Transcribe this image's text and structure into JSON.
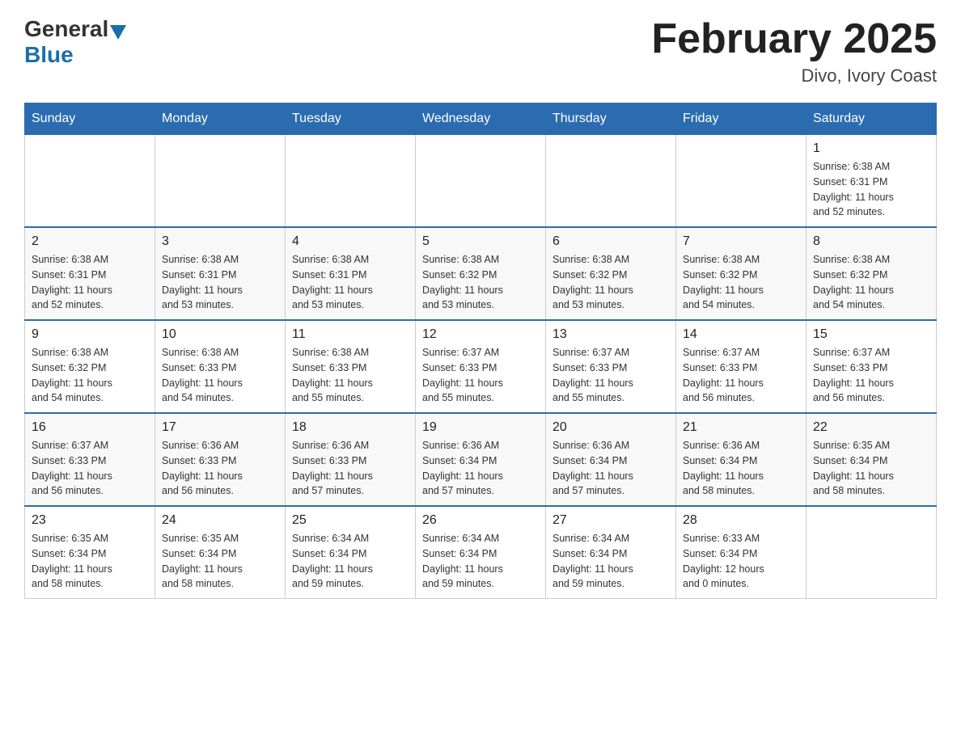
{
  "header": {
    "logo_general": "General",
    "logo_blue": "Blue",
    "month_title": "February 2025",
    "location": "Divo, Ivory Coast"
  },
  "days_of_week": [
    "Sunday",
    "Monday",
    "Tuesday",
    "Wednesday",
    "Thursday",
    "Friday",
    "Saturday"
  ],
  "weeks": [
    {
      "days": [
        {
          "num": "",
          "info": ""
        },
        {
          "num": "",
          "info": ""
        },
        {
          "num": "",
          "info": ""
        },
        {
          "num": "",
          "info": ""
        },
        {
          "num": "",
          "info": ""
        },
        {
          "num": "",
          "info": ""
        },
        {
          "num": "1",
          "info": "Sunrise: 6:38 AM\nSunset: 6:31 PM\nDaylight: 11 hours\nand 52 minutes."
        }
      ]
    },
    {
      "days": [
        {
          "num": "2",
          "info": "Sunrise: 6:38 AM\nSunset: 6:31 PM\nDaylight: 11 hours\nand 52 minutes."
        },
        {
          "num": "3",
          "info": "Sunrise: 6:38 AM\nSunset: 6:31 PM\nDaylight: 11 hours\nand 53 minutes."
        },
        {
          "num": "4",
          "info": "Sunrise: 6:38 AM\nSunset: 6:31 PM\nDaylight: 11 hours\nand 53 minutes."
        },
        {
          "num": "5",
          "info": "Sunrise: 6:38 AM\nSunset: 6:32 PM\nDaylight: 11 hours\nand 53 minutes."
        },
        {
          "num": "6",
          "info": "Sunrise: 6:38 AM\nSunset: 6:32 PM\nDaylight: 11 hours\nand 53 minutes."
        },
        {
          "num": "7",
          "info": "Sunrise: 6:38 AM\nSunset: 6:32 PM\nDaylight: 11 hours\nand 54 minutes."
        },
        {
          "num": "8",
          "info": "Sunrise: 6:38 AM\nSunset: 6:32 PM\nDaylight: 11 hours\nand 54 minutes."
        }
      ]
    },
    {
      "days": [
        {
          "num": "9",
          "info": "Sunrise: 6:38 AM\nSunset: 6:32 PM\nDaylight: 11 hours\nand 54 minutes."
        },
        {
          "num": "10",
          "info": "Sunrise: 6:38 AM\nSunset: 6:33 PM\nDaylight: 11 hours\nand 54 minutes."
        },
        {
          "num": "11",
          "info": "Sunrise: 6:38 AM\nSunset: 6:33 PM\nDaylight: 11 hours\nand 55 minutes."
        },
        {
          "num": "12",
          "info": "Sunrise: 6:37 AM\nSunset: 6:33 PM\nDaylight: 11 hours\nand 55 minutes."
        },
        {
          "num": "13",
          "info": "Sunrise: 6:37 AM\nSunset: 6:33 PM\nDaylight: 11 hours\nand 55 minutes."
        },
        {
          "num": "14",
          "info": "Sunrise: 6:37 AM\nSunset: 6:33 PM\nDaylight: 11 hours\nand 56 minutes."
        },
        {
          "num": "15",
          "info": "Sunrise: 6:37 AM\nSunset: 6:33 PM\nDaylight: 11 hours\nand 56 minutes."
        }
      ]
    },
    {
      "days": [
        {
          "num": "16",
          "info": "Sunrise: 6:37 AM\nSunset: 6:33 PM\nDaylight: 11 hours\nand 56 minutes."
        },
        {
          "num": "17",
          "info": "Sunrise: 6:36 AM\nSunset: 6:33 PM\nDaylight: 11 hours\nand 56 minutes."
        },
        {
          "num": "18",
          "info": "Sunrise: 6:36 AM\nSunset: 6:33 PM\nDaylight: 11 hours\nand 57 minutes."
        },
        {
          "num": "19",
          "info": "Sunrise: 6:36 AM\nSunset: 6:34 PM\nDaylight: 11 hours\nand 57 minutes."
        },
        {
          "num": "20",
          "info": "Sunrise: 6:36 AM\nSunset: 6:34 PM\nDaylight: 11 hours\nand 57 minutes."
        },
        {
          "num": "21",
          "info": "Sunrise: 6:36 AM\nSunset: 6:34 PM\nDaylight: 11 hours\nand 58 minutes."
        },
        {
          "num": "22",
          "info": "Sunrise: 6:35 AM\nSunset: 6:34 PM\nDaylight: 11 hours\nand 58 minutes."
        }
      ]
    },
    {
      "days": [
        {
          "num": "23",
          "info": "Sunrise: 6:35 AM\nSunset: 6:34 PM\nDaylight: 11 hours\nand 58 minutes."
        },
        {
          "num": "24",
          "info": "Sunrise: 6:35 AM\nSunset: 6:34 PM\nDaylight: 11 hours\nand 58 minutes."
        },
        {
          "num": "25",
          "info": "Sunrise: 6:34 AM\nSunset: 6:34 PM\nDaylight: 11 hours\nand 59 minutes."
        },
        {
          "num": "26",
          "info": "Sunrise: 6:34 AM\nSunset: 6:34 PM\nDaylight: 11 hours\nand 59 minutes."
        },
        {
          "num": "27",
          "info": "Sunrise: 6:34 AM\nSunset: 6:34 PM\nDaylight: 11 hours\nand 59 minutes."
        },
        {
          "num": "28",
          "info": "Sunrise: 6:33 AM\nSunset: 6:34 PM\nDaylight: 12 hours\nand 0 minutes."
        },
        {
          "num": "",
          "info": ""
        }
      ]
    }
  ]
}
